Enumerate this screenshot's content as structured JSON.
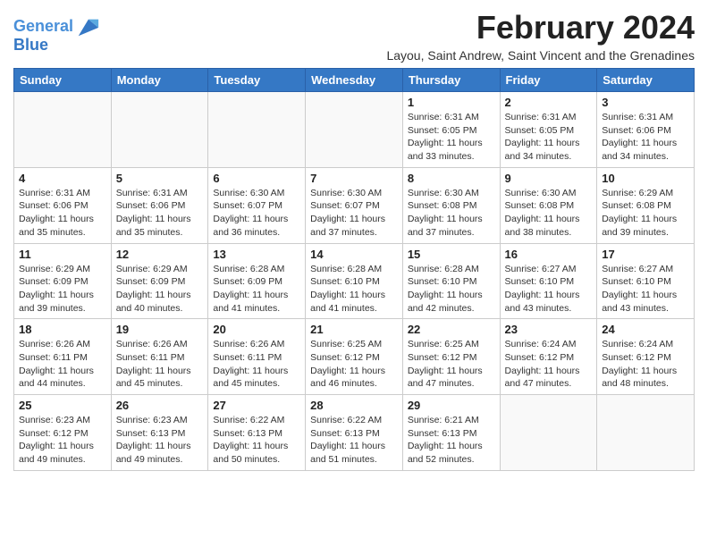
{
  "logo": {
    "line1": "General",
    "line2": "Blue"
  },
  "title": "February 2024",
  "subtitle": "Layou, Saint Andrew, Saint Vincent and the Grenadines",
  "days_of_week": [
    "Sunday",
    "Monday",
    "Tuesday",
    "Wednesday",
    "Thursday",
    "Friday",
    "Saturday"
  ],
  "weeks": [
    [
      {
        "day": "",
        "info": ""
      },
      {
        "day": "",
        "info": ""
      },
      {
        "day": "",
        "info": ""
      },
      {
        "day": "",
        "info": ""
      },
      {
        "day": "1",
        "info": "Sunrise: 6:31 AM\nSunset: 6:05 PM\nDaylight: 11 hours and 33 minutes."
      },
      {
        "day": "2",
        "info": "Sunrise: 6:31 AM\nSunset: 6:05 PM\nDaylight: 11 hours and 34 minutes."
      },
      {
        "day": "3",
        "info": "Sunrise: 6:31 AM\nSunset: 6:06 PM\nDaylight: 11 hours and 34 minutes."
      }
    ],
    [
      {
        "day": "4",
        "info": "Sunrise: 6:31 AM\nSunset: 6:06 PM\nDaylight: 11 hours and 35 minutes."
      },
      {
        "day": "5",
        "info": "Sunrise: 6:31 AM\nSunset: 6:06 PM\nDaylight: 11 hours and 35 minutes."
      },
      {
        "day": "6",
        "info": "Sunrise: 6:30 AM\nSunset: 6:07 PM\nDaylight: 11 hours and 36 minutes."
      },
      {
        "day": "7",
        "info": "Sunrise: 6:30 AM\nSunset: 6:07 PM\nDaylight: 11 hours and 37 minutes."
      },
      {
        "day": "8",
        "info": "Sunrise: 6:30 AM\nSunset: 6:08 PM\nDaylight: 11 hours and 37 minutes."
      },
      {
        "day": "9",
        "info": "Sunrise: 6:30 AM\nSunset: 6:08 PM\nDaylight: 11 hours and 38 minutes."
      },
      {
        "day": "10",
        "info": "Sunrise: 6:29 AM\nSunset: 6:08 PM\nDaylight: 11 hours and 39 minutes."
      }
    ],
    [
      {
        "day": "11",
        "info": "Sunrise: 6:29 AM\nSunset: 6:09 PM\nDaylight: 11 hours and 39 minutes."
      },
      {
        "day": "12",
        "info": "Sunrise: 6:29 AM\nSunset: 6:09 PM\nDaylight: 11 hours and 40 minutes."
      },
      {
        "day": "13",
        "info": "Sunrise: 6:28 AM\nSunset: 6:09 PM\nDaylight: 11 hours and 41 minutes."
      },
      {
        "day": "14",
        "info": "Sunrise: 6:28 AM\nSunset: 6:10 PM\nDaylight: 11 hours and 41 minutes."
      },
      {
        "day": "15",
        "info": "Sunrise: 6:28 AM\nSunset: 6:10 PM\nDaylight: 11 hours and 42 minutes."
      },
      {
        "day": "16",
        "info": "Sunrise: 6:27 AM\nSunset: 6:10 PM\nDaylight: 11 hours and 43 minutes."
      },
      {
        "day": "17",
        "info": "Sunrise: 6:27 AM\nSunset: 6:10 PM\nDaylight: 11 hours and 43 minutes."
      }
    ],
    [
      {
        "day": "18",
        "info": "Sunrise: 6:26 AM\nSunset: 6:11 PM\nDaylight: 11 hours and 44 minutes."
      },
      {
        "day": "19",
        "info": "Sunrise: 6:26 AM\nSunset: 6:11 PM\nDaylight: 11 hours and 45 minutes."
      },
      {
        "day": "20",
        "info": "Sunrise: 6:26 AM\nSunset: 6:11 PM\nDaylight: 11 hours and 45 minutes."
      },
      {
        "day": "21",
        "info": "Sunrise: 6:25 AM\nSunset: 6:12 PM\nDaylight: 11 hours and 46 minutes."
      },
      {
        "day": "22",
        "info": "Sunrise: 6:25 AM\nSunset: 6:12 PM\nDaylight: 11 hours and 47 minutes."
      },
      {
        "day": "23",
        "info": "Sunrise: 6:24 AM\nSunset: 6:12 PM\nDaylight: 11 hours and 47 minutes."
      },
      {
        "day": "24",
        "info": "Sunrise: 6:24 AM\nSunset: 6:12 PM\nDaylight: 11 hours and 48 minutes."
      }
    ],
    [
      {
        "day": "25",
        "info": "Sunrise: 6:23 AM\nSunset: 6:12 PM\nDaylight: 11 hours and 49 minutes."
      },
      {
        "day": "26",
        "info": "Sunrise: 6:23 AM\nSunset: 6:13 PM\nDaylight: 11 hours and 49 minutes."
      },
      {
        "day": "27",
        "info": "Sunrise: 6:22 AM\nSunset: 6:13 PM\nDaylight: 11 hours and 50 minutes."
      },
      {
        "day": "28",
        "info": "Sunrise: 6:22 AM\nSunset: 6:13 PM\nDaylight: 11 hours and 51 minutes."
      },
      {
        "day": "29",
        "info": "Sunrise: 6:21 AM\nSunset: 6:13 PM\nDaylight: 11 hours and 52 minutes."
      },
      {
        "day": "",
        "info": ""
      },
      {
        "day": "",
        "info": ""
      }
    ]
  ]
}
